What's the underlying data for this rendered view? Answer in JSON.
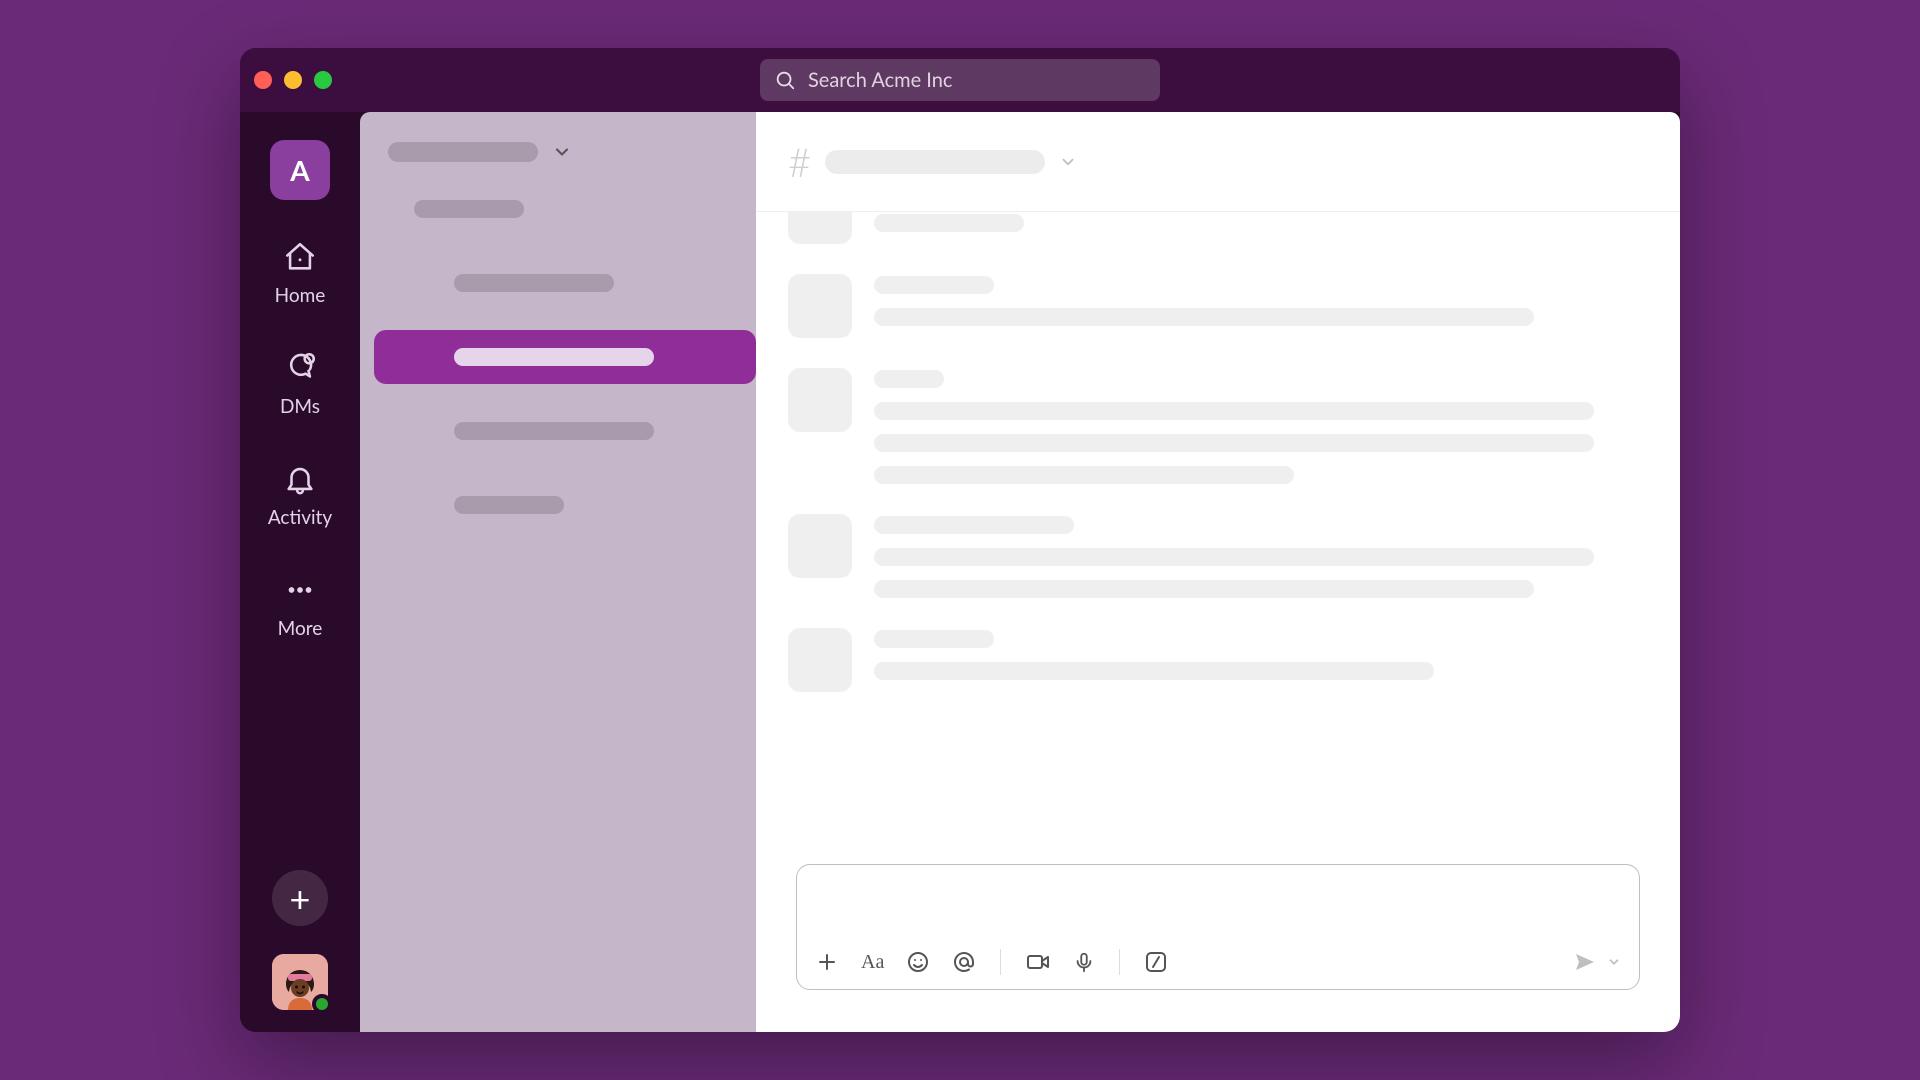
{
  "window": {
    "search_placeholder": "Search Acme Inc"
  },
  "rail": {
    "workspace_initial": "A",
    "items": [
      {
        "id": "home",
        "label": "Home"
      },
      {
        "id": "dms",
        "label": "DMs"
      },
      {
        "id": "activity",
        "label": "Activity"
      },
      {
        "id": "more",
        "label": "More"
      }
    ],
    "add_label": "+",
    "user": {
      "presence": "active"
    }
  },
  "sidebar": {},
  "channel": {},
  "composer": {
    "placeholder": "",
    "toolbar": {
      "attach": "plus-icon",
      "format": "format-icon",
      "emoji": "emoji-icon",
      "mention": "mention-icon",
      "video": "video-icon",
      "audio": "microphone-icon",
      "slash": "slash-command-icon",
      "send": "send-icon",
      "send_options": "chevron-down-icon"
    }
  }
}
